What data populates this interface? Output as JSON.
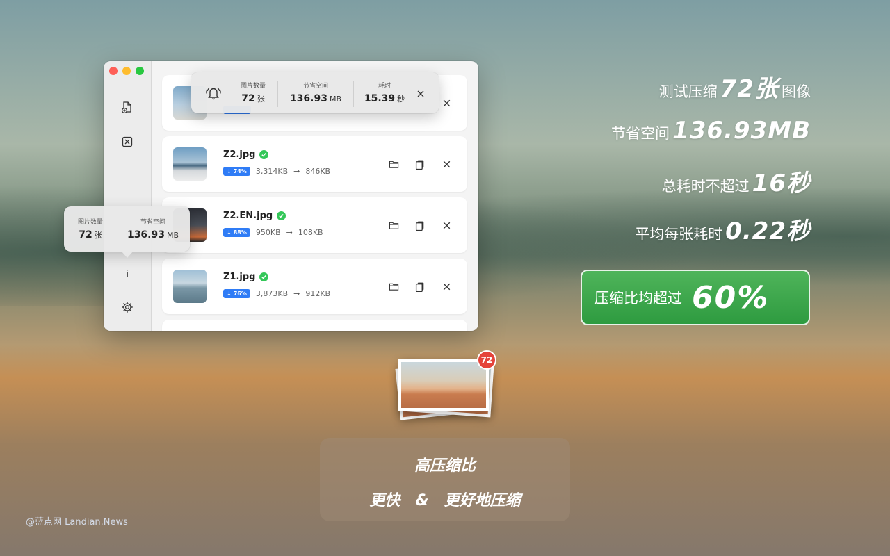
{
  "window": {
    "files": [
      {
        "name": "",
        "percent": "",
        "before": "",
        "after": ""
      },
      {
        "name": "Z2.jpg",
        "percent": "74%",
        "before": "3,314KB",
        "after": "846KB"
      },
      {
        "name": "Z2.EN.jpg",
        "percent": "88%",
        "before": "950KB",
        "after": "108KB"
      },
      {
        "name": "Z1.jpg",
        "percent": "76%",
        "before": "3,873KB",
        "after": "912KB"
      }
    ],
    "arrow": "→"
  },
  "top_popover": {
    "count_label": "图片数量",
    "count_value": "72",
    "count_unit": "张",
    "saved_label": "节省空间",
    "saved_value": "136.93",
    "saved_unit": "MB",
    "time_label": "耗时",
    "time_value": "15.39",
    "time_unit": "秒"
  },
  "side_popover": {
    "count_label": "图片数量",
    "count_value": "72",
    "count_unit": "张",
    "saved_label": "节省空间",
    "saved_value": "136.93",
    "saved_unit": "MB"
  },
  "info_glyph": "i",
  "headlines": {
    "h1_pre": "测试压缩",
    "h1_big": "72张",
    "h1_post": "图像",
    "h2_pre": "节省空间",
    "h2_big": "136.93MB",
    "h3_pre": "总耗时不超过",
    "h3_big": "16秒",
    "h4_pre": "平均每张耗时",
    "h4_big": "0.22秒",
    "ratio_pre": "压缩比均超过",
    "ratio_big": "60%"
  },
  "badge_count": "72",
  "card": {
    "line1": "高压缩比",
    "line2": "更快　&　更好地压缩"
  },
  "watermark": "@蓝点网 Landian.News"
}
